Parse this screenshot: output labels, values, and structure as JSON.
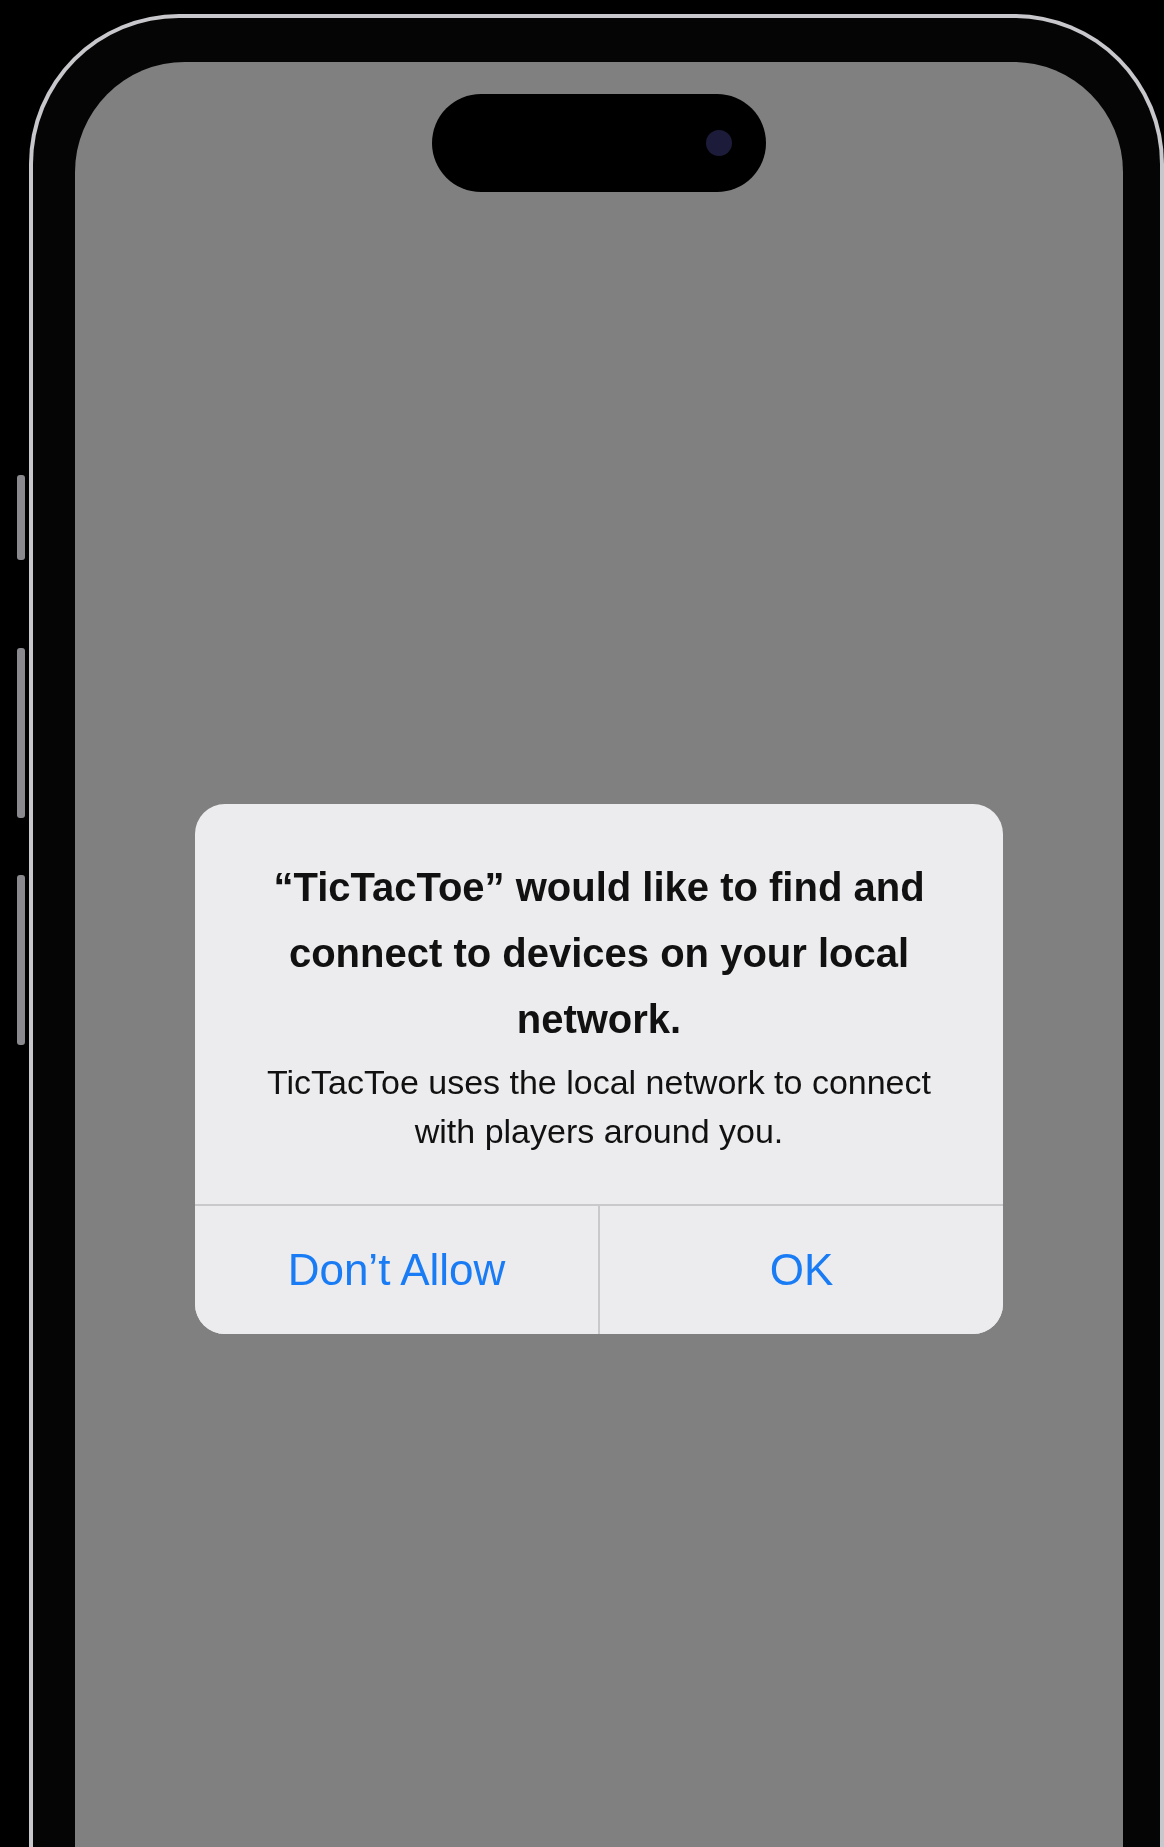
{
  "dialog": {
    "title": "“TicTacToe” would like to find and connect to devices on your local network.",
    "message": "TicTacToe uses the local network to connect with players around you.",
    "buttons": [
      {
        "label": "Don’t Allow"
      },
      {
        "label": "OK"
      }
    ]
  }
}
